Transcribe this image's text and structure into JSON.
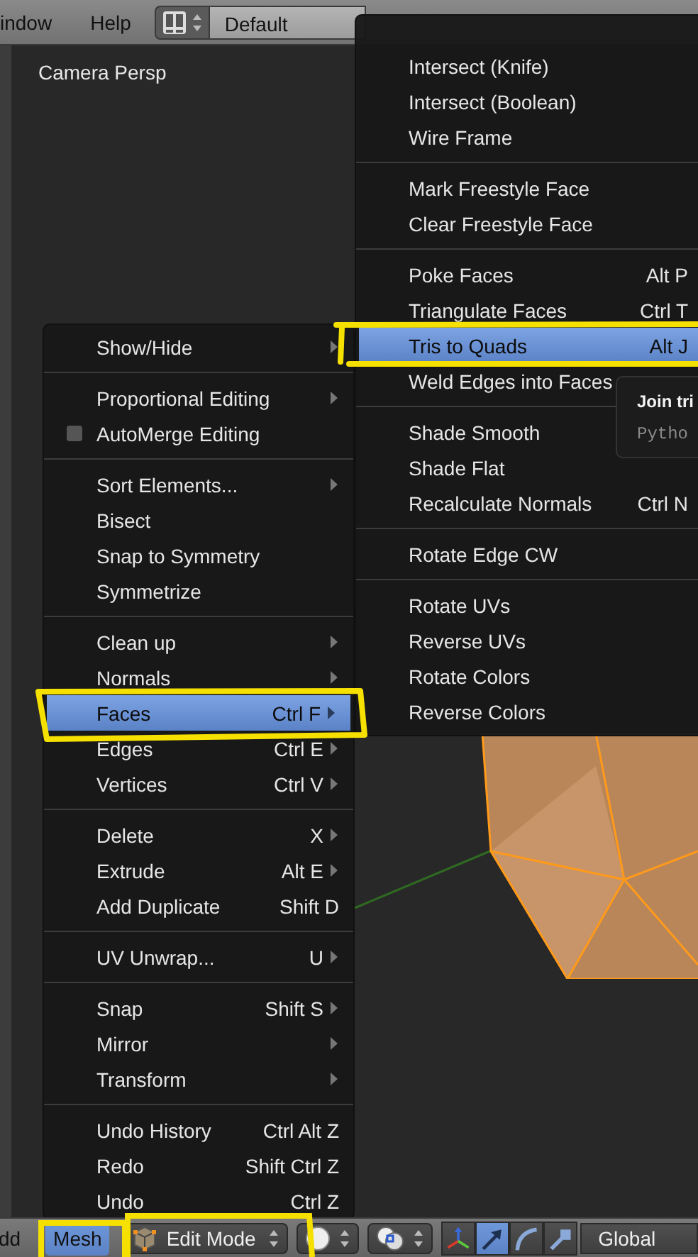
{
  "header": {
    "menus": [
      {
        "label": "indow"
      },
      {
        "label": "Help"
      }
    ],
    "layout": "Default"
  },
  "viewport": {
    "label": "Camera Persp"
  },
  "mesh_menu": {
    "groups": [
      [
        {
          "kind": "item",
          "label": "Show/Hide",
          "submenu": true,
          "selected": false
        }
      ],
      [
        {
          "kind": "item",
          "label": "Proportional Editing",
          "submenu": true,
          "selected": false
        },
        {
          "kind": "check",
          "label": "AutoMerge Editing",
          "checked": false,
          "submenu": false,
          "selected": false
        }
      ],
      [
        {
          "kind": "item",
          "label": "Sort Elements...",
          "submenu": true,
          "selected": false
        },
        {
          "kind": "item",
          "label": "Bisect",
          "submenu": false,
          "selected": false
        },
        {
          "kind": "item",
          "label": "Snap to Symmetry",
          "submenu": false,
          "selected": false
        },
        {
          "kind": "item",
          "label": "Symmetrize",
          "submenu": false,
          "selected": false
        }
      ],
      [
        {
          "kind": "item",
          "label": "Clean up",
          "submenu": true,
          "selected": false
        },
        {
          "kind": "item",
          "label": "Normals",
          "submenu": true,
          "selected": false
        },
        {
          "kind": "item",
          "label": "Faces",
          "shortcut": "Ctrl F",
          "submenu": true,
          "selected": true
        },
        {
          "kind": "item",
          "label": "Edges",
          "shortcut": "Ctrl E",
          "submenu": true,
          "selected": false
        },
        {
          "kind": "item",
          "label": "Vertices",
          "shortcut": "Ctrl V",
          "submenu": true,
          "selected": false
        }
      ],
      [
        {
          "kind": "item",
          "label": "Delete",
          "shortcut": "X",
          "submenu": true,
          "selected": false
        },
        {
          "kind": "item",
          "label": "Extrude",
          "shortcut": "Alt E",
          "submenu": true,
          "selected": false
        },
        {
          "kind": "item",
          "label": "Add Duplicate",
          "shortcut": "Shift D",
          "submenu": false,
          "selected": false
        }
      ],
      [
        {
          "kind": "item",
          "label": "UV Unwrap...",
          "shortcut": "U",
          "submenu": true,
          "selected": false
        }
      ],
      [
        {
          "kind": "item",
          "label": "Snap",
          "shortcut": "Shift S",
          "submenu": true,
          "selected": false
        },
        {
          "kind": "item",
          "label": "Mirror",
          "submenu": true,
          "selected": false
        },
        {
          "kind": "item",
          "label": "Transform",
          "submenu": true,
          "selected": false
        }
      ],
      [
        {
          "kind": "item",
          "label": "Undo History",
          "shortcut": "Ctrl Alt Z",
          "submenu": false,
          "selected": false
        },
        {
          "kind": "item",
          "label": "Redo",
          "shortcut": "Shift Ctrl Z",
          "submenu": false,
          "selected": false
        },
        {
          "kind": "item",
          "label": "Undo",
          "shortcut": "Ctrl Z",
          "submenu": false,
          "selected": false
        }
      ]
    ]
  },
  "faces_menu": {
    "groups": [
      [
        {
          "kind": "item",
          "label": "Intersect (Knife)",
          "submenu": false,
          "selected": false
        },
        {
          "kind": "item",
          "label": "Intersect (Boolean)",
          "submenu": false,
          "selected": false
        },
        {
          "kind": "item",
          "label": "Wire Frame",
          "submenu": false,
          "selected": false
        }
      ],
      [
        {
          "kind": "item",
          "label": "Mark Freestyle Face",
          "submenu": false,
          "selected": false
        },
        {
          "kind": "item",
          "label": "Clear Freestyle Face",
          "submenu": false,
          "selected": false
        }
      ],
      [
        {
          "kind": "item",
          "label": "Poke Faces",
          "shortcut": "Alt P",
          "submenu": false,
          "selected": false
        },
        {
          "kind": "item",
          "label": "Triangulate Faces",
          "shortcut": "Ctrl T",
          "submenu": false,
          "selected": false
        },
        {
          "kind": "item",
          "label": "Tris to Quads",
          "shortcut": "Alt J",
          "submenu": false,
          "selected": true
        },
        {
          "kind": "item",
          "label": "Weld Edges into Faces",
          "submenu": false,
          "selected": false
        }
      ],
      [
        {
          "kind": "item",
          "label": "Shade Smooth",
          "submenu": false,
          "selected": false
        },
        {
          "kind": "item",
          "label": "Shade Flat",
          "submenu": false,
          "selected": false
        },
        {
          "kind": "item",
          "label": "Recalculate Normals",
          "shortcut": "Ctrl N",
          "submenu": false,
          "selected": false
        }
      ],
      [
        {
          "kind": "item",
          "label": "Rotate Edge CW",
          "submenu": false,
          "selected": false
        }
      ],
      [
        {
          "kind": "item",
          "label": "Rotate UVs",
          "submenu": false,
          "selected": false
        },
        {
          "kind": "item",
          "label": "Reverse UVs",
          "submenu": false,
          "selected": false
        },
        {
          "kind": "item",
          "label": "Rotate Colors",
          "submenu": false,
          "selected": false
        },
        {
          "kind": "item",
          "label": "Reverse Colors",
          "submenu": false,
          "selected": false
        }
      ]
    ]
  },
  "tooltip": {
    "title": "Join tri",
    "body": "Pytho"
  },
  "footer": {
    "items": [
      {
        "kind": "text",
        "label": "dd"
      },
      {
        "kind": "menu",
        "label": "Mesh",
        "selected": true
      },
      {
        "kind": "mode",
        "label": "Edit Mode"
      },
      {
        "kind": "shading"
      },
      {
        "kind": "pivot"
      },
      {
        "kind": "manipulators",
        "buttons": [
          {
            "selected": false
          },
          {
            "selected": true
          },
          {
            "selected": false
          },
          {
            "selected": false
          }
        ]
      },
      {
        "kind": "dropdown",
        "label": "Global"
      }
    ]
  }
}
